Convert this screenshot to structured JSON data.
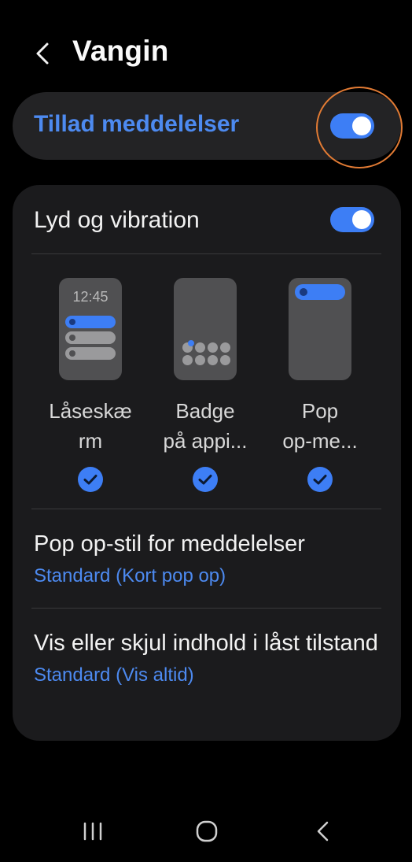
{
  "header": {
    "title": "Vangin",
    "back_icon": "chevron-left-icon"
  },
  "master": {
    "label": "Tillad meddelelser",
    "enabled": true
  },
  "sound": {
    "label": "Lyd og vibration",
    "enabled": true
  },
  "styles": [
    {
      "label_line1": "Låseskæ",
      "label_line2": "rm",
      "checked": true,
      "thumb_time": "12:45"
    },
    {
      "label_line1": "Badge",
      "label_line2": "på appi...",
      "checked": true
    },
    {
      "label_line1": "Pop",
      "label_line2": "op-me...",
      "checked": true
    }
  ],
  "popup_style": {
    "title": "Pop op-stil for meddelelser",
    "value": "Standard (Kort pop op)"
  },
  "lock_content": {
    "title": "Vis eller skjul indhold i låst tilstand",
    "value": "Standard (Vis altid)"
  },
  "navbar": {
    "recents_icon": "recents-icon",
    "home_icon": "home-icon",
    "back_icon": "back-icon"
  },
  "colors": {
    "accent": "#3d7ef5",
    "accent_text": "#4d8af0",
    "highlight": "#e27b34",
    "card": "#1b1b1d",
    "background": "#000000"
  }
}
